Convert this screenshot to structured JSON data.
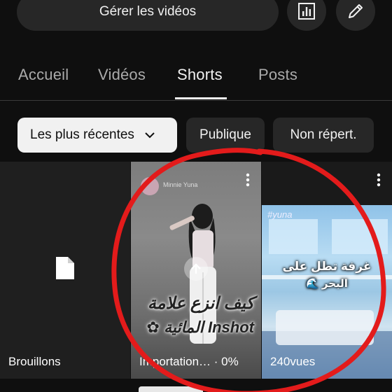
{
  "header": {
    "manage_label": "Gérer les vidéos",
    "analytics_icon": "analytics-icon",
    "edit_icon": "pencil-icon"
  },
  "tabs": [
    {
      "label": "Accueil",
      "active": false
    },
    {
      "label": "Vidéos",
      "active": false
    },
    {
      "label": "Shorts",
      "active": true
    },
    {
      "label": "Posts",
      "active": false
    }
  ],
  "filters": {
    "sort_label": "Les plus récentes",
    "public_label": "Publique",
    "unlisted_label": "Non répert."
  },
  "grid": {
    "drafts": {
      "label": "Brouillons",
      "icon": "document-icon"
    },
    "upload": {
      "label": "Importation… · 0%",
      "overlay_line1": "كيف انزع علامة",
      "overlay_line2": "Inshot المائية ✿",
      "channel_name": "Minnie Yuna",
      "upload_icon": "upload-arrow-icon"
    },
    "views": {
      "label": "240vues",
      "caption_line1": "غرفة تطل على",
      "caption_line2": "البحر 🌊",
      "tag": "#yuna"
    }
  },
  "annotation": {
    "color": "#e31b1b",
    "shape": "hand-drawn circle"
  }
}
